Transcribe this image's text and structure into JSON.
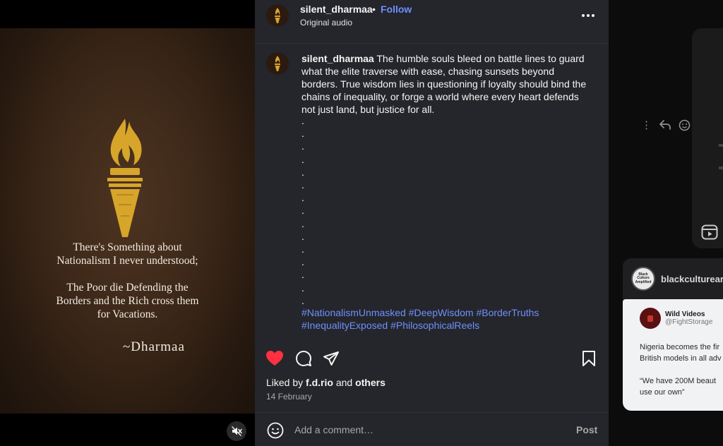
{
  "post": {
    "username": "silent_dharmaa",
    "separator": "•",
    "follow_label": "Follow",
    "audio": "Original audio",
    "caption_text": " The humble souls bleed on battle lines to guard what the elite traverse with ease, chasing sunsets beyond borders. True wisdom lies in questioning if loyalty should bind the chains of inequality, or forge a world where every heart defends not just land, but justice for all.",
    "dots": ".\n.\n.\n.\n.\n.\n.\n.\n.\n.\n.\n.\n.\n.\n.",
    "hashtags": [
      "#NationalismUnmasked",
      "#DeepWisdom",
      "#BorderTruths",
      "#InequalityExposed",
      "#PhilosophicalReels"
    ],
    "liked_by_prefix": "Liked by ",
    "liked_by_user": "f.d.rio",
    "liked_by_and": " and ",
    "liked_by_others": "others",
    "date": "14 February",
    "comment_placeholder": "Add a comment…",
    "post_label": "Post"
  },
  "media": {
    "quote_line1": "There's Something about",
    "quote_line2": "Nationalism I never understood;",
    "quote_line3": "The Poor die Defending the",
    "quote_line4": "Borders and the Rich cross them",
    "quote_line5": "for Vacations.",
    "signature": "~Dharmaa"
  },
  "background": {
    "card_account": "blackculturear",
    "avatar_text": "Black Culture Amplified",
    "tweet_name": "Wild Videos",
    "tweet_handle": "@FightStorage",
    "tweet_line1": "Nigeria becomes the fir",
    "tweet_line2": "British models in all adv",
    "tweet_line3": "“We have 200M beaut",
    "tweet_line4": "use our own”"
  },
  "colors": {
    "accent": "#6f8ffb",
    "like": "#ff3040",
    "panel": "#25262b",
    "torch": "#d7a52a"
  },
  "icons": [
    "torch-icon",
    "more-icon",
    "heart-icon",
    "comment-icon",
    "share-icon",
    "bookmark-icon",
    "emoji-icon",
    "mute-icon",
    "reply-icon",
    "reels-icon"
  ]
}
